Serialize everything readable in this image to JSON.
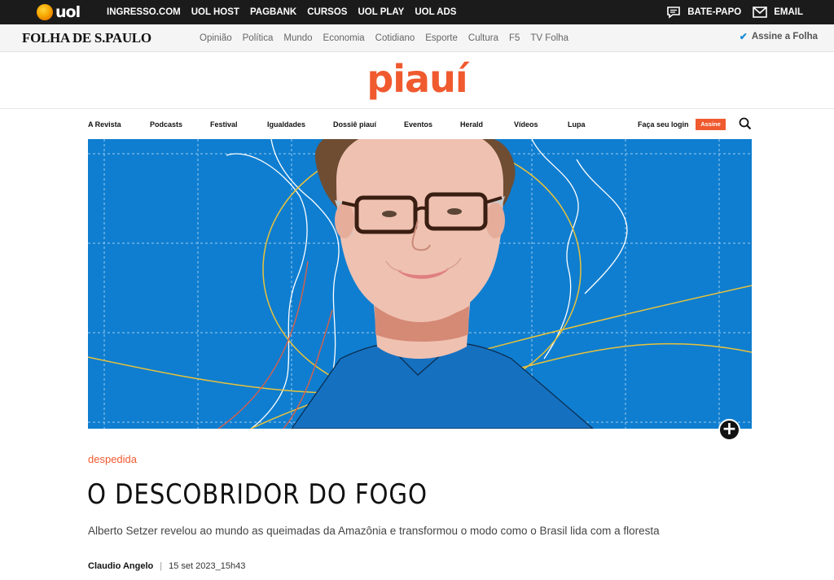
{
  "uol_bar": {
    "logo_text": "uol",
    "links": [
      "INGRESSO.COM",
      "UOL HOST",
      "PAGBANK",
      "CURSOS",
      "UOL PLAY",
      "UOL ADS"
    ],
    "bate_papo": "BATE-PAPO",
    "email": "EMAIL",
    "chat_icon": "chat-bubble-icon",
    "mail_icon": "envelope-icon"
  },
  "folha_bar": {
    "logo": "FOLHA DE S.PAULO",
    "nav": [
      "Opinião",
      "Política",
      "Mundo",
      "Economia",
      "Cotidiano",
      "Esporte",
      "Cultura",
      "F5",
      "TV Folha"
    ],
    "subscribe": "Assine a Folha",
    "subscribe_icon": "check-icon"
  },
  "masthead": {
    "logo": "piauí",
    "brand_color": "#f05a2f"
  },
  "section_nav": {
    "items": [
      "A Revista",
      "Podcasts",
      "Festival",
      "Igualdades",
      "Dossiê piauí",
      "Eventos",
      "Herald",
      "Vídeos",
      "Lupa"
    ],
    "login": "Faça seu login",
    "subscribe": "Assine",
    "search_icon": "search-icon"
  },
  "hero": {
    "expand_symbol": "+",
    "expand_icon": "plus-circle-icon",
    "background_color": "#0f7ed0"
  },
  "article": {
    "kicker": "despedida",
    "title": "O DESCOBRIDOR DO FOGO",
    "dek": "Alberto Setzer revelou ao mundo as queimadas da Amazônia e transformou o modo como o Brasil lida com a floresta",
    "author": "Claudio Angelo",
    "separator": "|",
    "date": "15 set 2023_15h43"
  }
}
